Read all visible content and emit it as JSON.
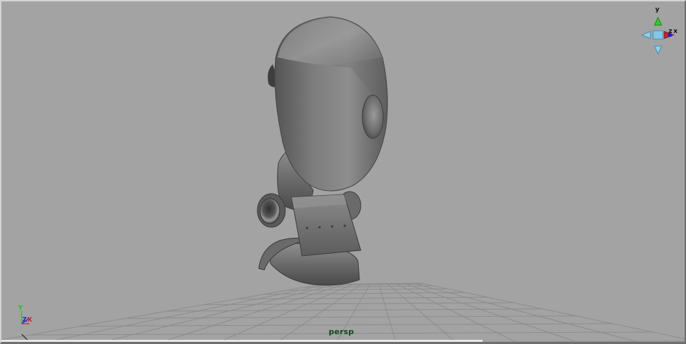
{
  "viewport": {
    "camera_label": "persp"
  },
  "view_cube": {
    "y_label": "y",
    "z_label": "z",
    "x_label": "x"
  },
  "origin_axis": {
    "y_label": "Y",
    "z_label": "Z",
    "x_label": "X"
  },
  "colors": {
    "background": "#a3a3a3",
    "grid": "#8c8c8c",
    "axis_y": "#22c022",
    "axis_x": "#d22020",
    "axis_z": "#2020d0",
    "camera_label": "#124a1c"
  }
}
